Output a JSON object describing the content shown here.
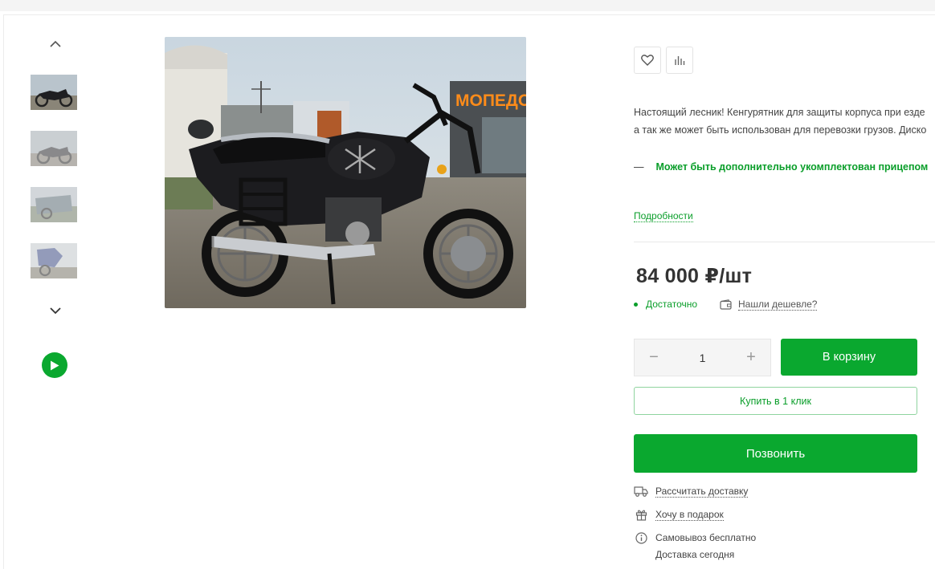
{
  "product": {
    "description_lines": [
      "Настоящий лесник! Кенгурятник для защиты корпуса при езде",
      "а так же может быть использован для перевозки грузов. Диско"
    ],
    "feature": "Может быть дополнительно укомплектован прицепом",
    "feature_dash": "—",
    "details_link": "Подробности",
    "price": "84 000 ₽/шт",
    "stock_status": "Достаточно",
    "cheaper_link": "Нашли дешевле?",
    "main_image_sign": "МОПЕДО"
  },
  "gallery": {
    "thumbnails": [
      {
        "name": "thumb-1",
        "active": true
      },
      {
        "name": "thumb-2",
        "active": false
      },
      {
        "name": "thumb-3",
        "active": false
      },
      {
        "name": "thumb-4",
        "active": false
      }
    ]
  },
  "cart": {
    "quantity": "1",
    "minus": "−",
    "plus": "+",
    "add_to_cart": "В корзину",
    "buy_one_click": "Купить в 1 клик",
    "call": "Позвонить"
  },
  "services": {
    "delivery_calc": "Рассчитать доставку",
    "gift": "Хочу в подарок",
    "pickup": "Самовывоз бесплатно",
    "delivery_today": "Доставка сегодня"
  },
  "icons": {
    "favorite": "heart-icon",
    "compare": "bar-chart-icon",
    "play": "play-icon",
    "truck": "truck-icon",
    "gift": "gift-icon",
    "info": "info-icon",
    "wallet": "wallet-icon"
  },
  "colors": {
    "accent": "#0aa82f",
    "accent_text": "#0a9e2a"
  }
}
